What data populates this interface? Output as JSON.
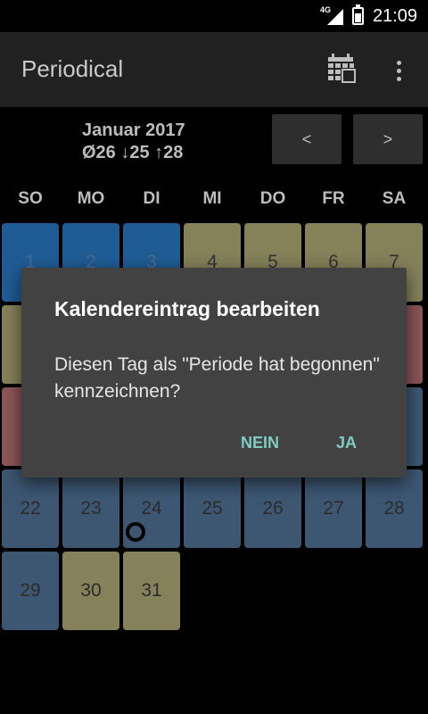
{
  "statusbar": {
    "network": "4G",
    "time": "21:09"
  },
  "appbar": {
    "title": "Periodical",
    "calendar_icon": "calendar-icon",
    "menu_icon": "overflow-menu-icon"
  },
  "header": {
    "month": "Januar 2017",
    "stats": "Ø26 ↓25 ↑28",
    "prev_label": "<",
    "next_label": ">"
  },
  "weekdays": [
    "SO",
    "MO",
    "DI",
    "MI",
    "DO",
    "FR",
    "SA"
  ],
  "days": {
    "d1": "1",
    "d2": "2",
    "d3": "3",
    "d4": "4",
    "d5": "5",
    "d6": "6",
    "d7": "7",
    "d22": "22",
    "d23": "23",
    "d24": "24",
    "d25": "25",
    "d26": "26",
    "d27": "27",
    "d28": "28",
    "d29": "29",
    "d30": "30",
    "d31": "31"
  },
  "colors": {
    "period": "#1f5c96",
    "fertile": "#85825a",
    "ovulation": "#8c5658",
    "infertile": "#3d5773",
    "dialog_button": "#7fcbc4"
  },
  "dialog": {
    "title": "Kalendereintrag bearbeiten",
    "message": "Diesen Tag als \"Periode hat begonnen\" kennzeichnen?",
    "negative": "NEIN",
    "positive": "JA"
  }
}
